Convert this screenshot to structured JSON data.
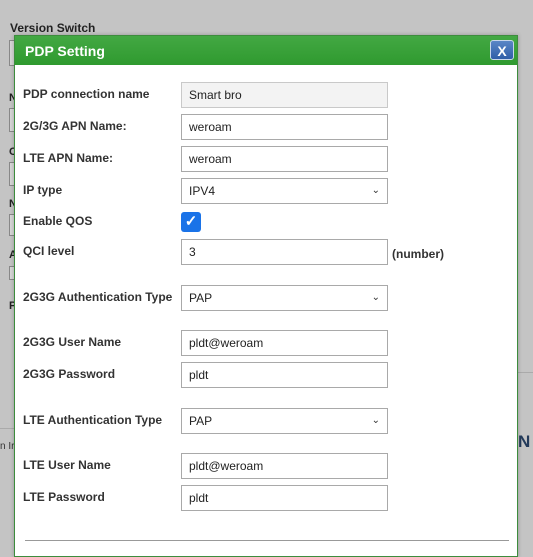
{
  "background": {
    "section_title": "Version Switch",
    "right_fragment": "N",
    "left_fragment": "n Ir"
  },
  "dialog": {
    "title": "PDP Setting",
    "close_label": "X",
    "fields": {
      "connection_name": {
        "label": "PDP connection name",
        "value": "Smart bro"
      },
      "apn_2g3g": {
        "label": "2G/3G APN Name:",
        "value": "weroam"
      },
      "apn_lte": {
        "label": "LTE APN Name:",
        "value": "weroam"
      },
      "ip_type": {
        "label": "IP type",
        "value": "IPV4"
      },
      "enable_qos": {
        "label": "Enable QOS",
        "checked": true
      },
      "qci_level": {
        "label": "QCI level",
        "value": "3",
        "unit": "(number)"
      },
      "auth_2g3g": {
        "label": "2G3G Authentication Type",
        "value": "PAP"
      },
      "user_2g3g": {
        "label": "2G3G User Name",
        "value": "pldt@weroam"
      },
      "pass_2g3g": {
        "label": "2G3G Password",
        "value": "pldt"
      },
      "auth_lte": {
        "label": "LTE Authentication Type",
        "value": "PAP"
      },
      "user_lte": {
        "label": "LTE User Name",
        "value": "pldt@weroam"
      },
      "pass_lte": {
        "label": "LTE Password",
        "value": "pldt"
      }
    }
  }
}
